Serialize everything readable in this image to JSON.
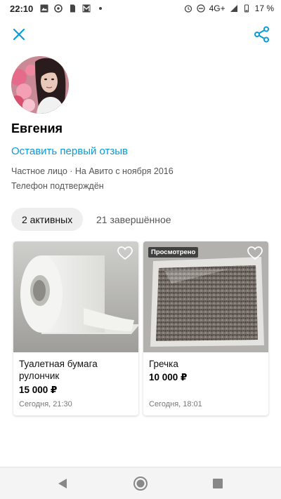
{
  "status_bar": {
    "time": "22:10",
    "network": "4G+",
    "battery": "17 %",
    "icons_left": [
      "image-icon",
      "sync-icon",
      "file-icon",
      "gallery-icon",
      "dot-icon"
    ],
    "icons_right": [
      "alarm-icon",
      "dnd-icon",
      "signal-icon",
      "battery-icon"
    ]
  },
  "appbar": {
    "close_icon": "close-icon",
    "share_icon": "share-icon",
    "accent": "#0a9bd9"
  },
  "profile": {
    "name": "Евгения",
    "review_link": "Оставить первый отзыв",
    "meta_line1": "Частное лицо · На Авито с ноября 2016",
    "meta_line2": "Телефон подтверждён"
  },
  "tabs": [
    {
      "label": "2 активных",
      "active": true
    },
    {
      "label": "21 завершённое",
      "active": false
    }
  ],
  "listings": [
    {
      "title": "Туалетная бумага рулончик",
      "price": "15 000 ₽",
      "date": "Сегодня, 21:30",
      "badge": ""
    },
    {
      "title": "Гречка",
      "price": "10 000 ₽",
      "date": "Сегодня, 18:01",
      "badge": "Просмотрено"
    }
  ],
  "nav": {
    "back_icon": "back-triangle-icon",
    "home_icon": "home-circle-icon",
    "recent_icon": "recent-square-icon"
  }
}
